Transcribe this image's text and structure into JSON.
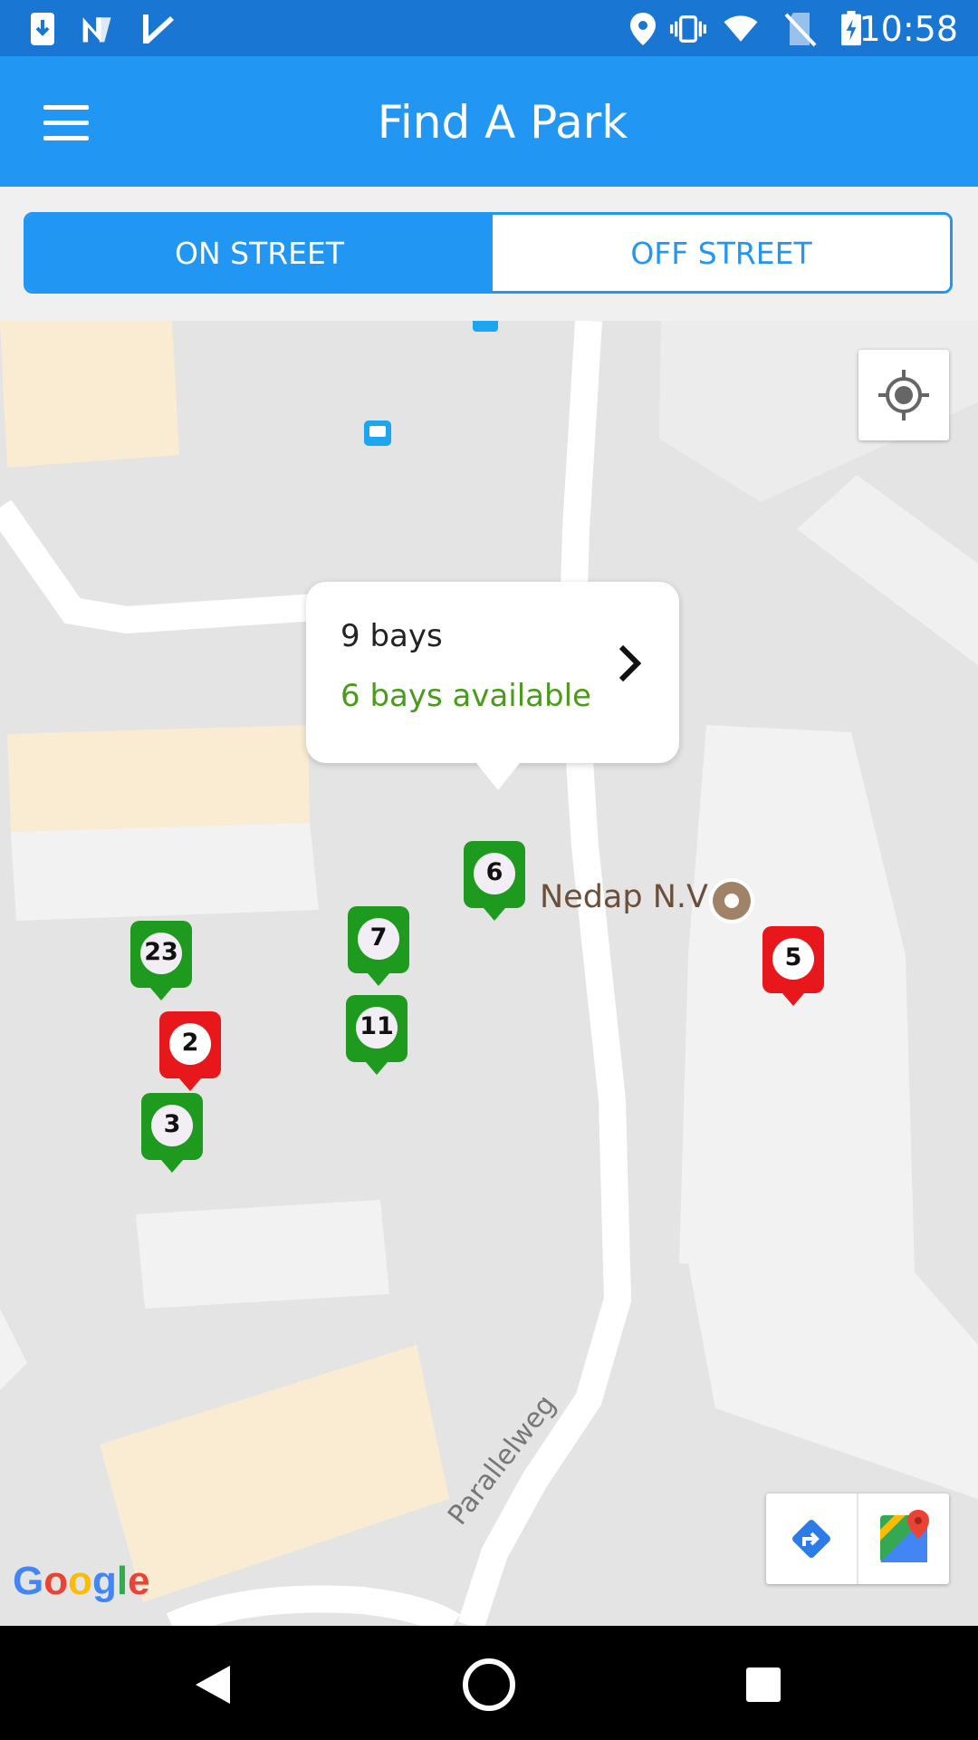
{
  "status_bar": {
    "time": "10:58",
    "icons": [
      "download-icon",
      "n-app-icon",
      "check-app-icon",
      "location-icon",
      "vibrate-icon",
      "wifi-icon",
      "no-sim-icon",
      "battery-charging-icon"
    ]
  },
  "app_bar": {
    "title": "Find A Park",
    "menu_icon": "hamburger-menu-icon"
  },
  "tabs": [
    {
      "label": "ON STREET",
      "selected": true
    },
    {
      "label": "OFF STREET",
      "selected": false
    }
  ],
  "map": {
    "popup": {
      "title": "9 bays",
      "subtitle": "6 bays available"
    },
    "markers": [
      {
        "label": "6",
        "color": "#1e9b1e"
      },
      {
        "label": "7",
        "color": "#1e9b1e"
      },
      {
        "label": "11",
        "color": "#1e9b1e"
      },
      {
        "label": "23",
        "color": "#1e9b1e"
      },
      {
        "label": "2",
        "color": "#e8171b"
      },
      {
        "label": "3",
        "color": "#1e9b1e"
      },
      {
        "label": "5",
        "color": "#e8171b"
      }
    ],
    "poi": {
      "name": "Nedap N.V"
    },
    "street": "Parallelweg",
    "attribution": "Google"
  },
  "colors": {
    "primary": "#2196F3",
    "status": "#1976D2",
    "available": "#4a9a1c"
  }
}
